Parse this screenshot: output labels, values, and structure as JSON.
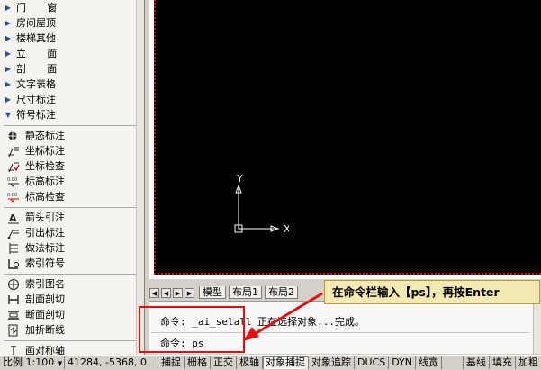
{
  "sidebar": {
    "menu_items": [
      {
        "label": "门 窗",
        "spread": true
      },
      {
        "label": "房间屋顶",
        "spread": false
      },
      {
        "label": "楼梯其他",
        "spread": false
      },
      {
        "label": "立 面",
        "spread": true
      },
      {
        "label": "剖 面",
        "spread": true
      },
      {
        "label": "文字表格",
        "spread": false
      },
      {
        "label": "尺寸标注",
        "spread": false
      },
      {
        "label": "符号标注",
        "spread": false
      }
    ],
    "tool_groups": [
      [
        {
          "label": "静态标注",
          "icon": "static-label-icon"
        },
        {
          "label": "坐标标注",
          "icon": "coordinate-label-icon"
        },
        {
          "label": "坐标检查",
          "icon": "coordinate-check-icon"
        },
        {
          "label": "标高标注",
          "icon": "elevation-label-icon"
        },
        {
          "label": "标高检查",
          "icon": "elevation-check-icon"
        }
      ],
      [
        {
          "label": "箭头引注",
          "icon": "arrow-note-icon"
        },
        {
          "label": "引出标注",
          "icon": "leader-label-icon"
        },
        {
          "label": "做法标注",
          "icon": "method-label-icon"
        },
        {
          "label": "索引符号",
          "icon": "index-symbol-icon"
        }
      ],
      [
        {
          "label": "索引图名",
          "icon": "index-title-icon"
        },
        {
          "label": "剖面剖切",
          "icon": "section-cut-icon"
        },
        {
          "label": "断面剖切",
          "icon": "break-section-icon"
        },
        {
          "label": "加折断线",
          "icon": "break-line-icon"
        }
      ],
      [
        {
          "label": "画对称轴",
          "icon": "symmetry-axis-icon"
        }
      ]
    ]
  },
  "canvas": {
    "ucs_y": "Y",
    "ucs_x": "X",
    "background": "#000000",
    "border_color": "#d00000"
  },
  "tabs": {
    "items": [
      "模型",
      "布局1",
      "布局2"
    ],
    "active": "模型"
  },
  "command": {
    "line1": "命令: _ai_selall 正在选择对象...完成。",
    "line2": "命令: ps"
  },
  "annotation": {
    "callout_text": "在命令栏输入【ps】，再按Enter",
    "callout_bg": "#f5e9b3",
    "highlight_color": "#e01010"
  },
  "statusbar": {
    "scale": "比例 1:100",
    "scale_arrow": "▼",
    "coords": "41284, -5368, 0",
    "buttons": [
      {
        "label": "捕捉",
        "on": false
      },
      {
        "label": "栅格",
        "on": false
      },
      {
        "label": "正交",
        "on": false
      },
      {
        "label": "极轴",
        "on": false
      },
      {
        "label": "对象捕捉",
        "on": true
      },
      {
        "label": "对象追踪",
        "on": false
      },
      {
        "label": "DUCS",
        "on": false
      },
      {
        "label": "DYN",
        "on": false
      },
      {
        "label": "线宽",
        "on": false
      }
    ],
    "right_buttons": [
      {
        "label": "基线",
        "on": false
      },
      {
        "label": "填充",
        "on": false
      },
      {
        "label": "加粗",
        "on": false
      }
    ]
  }
}
